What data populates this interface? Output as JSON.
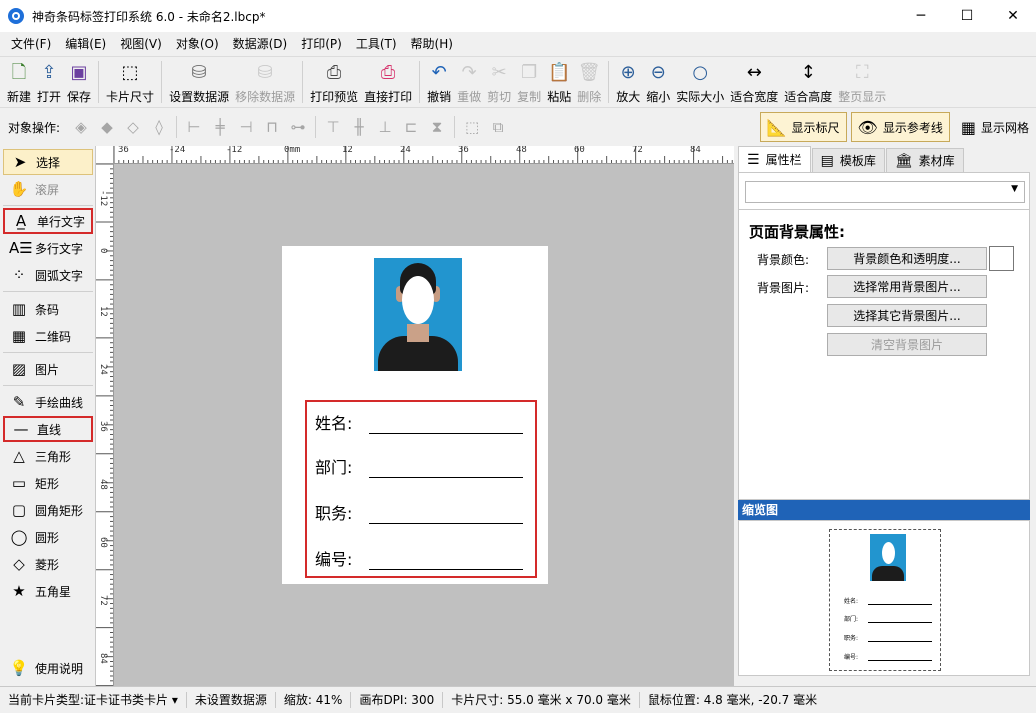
{
  "window": {
    "title": "神奇条码标签打印系统 6.0 - 未命名2.lbcp*",
    "minimize": "─",
    "maximize": "☐",
    "close": "✕"
  },
  "menu": [
    "文件(F)",
    "编辑(E)",
    "视图(V)",
    "对象(O)",
    "数据源(D)",
    "打印(P)",
    "工具(T)",
    "帮助(H)"
  ],
  "toolbar": {
    "new": "新建",
    "open": "打开",
    "save": "保存",
    "card_size": "卡片尺寸",
    "set_datasource": "设置数据源",
    "remove_datasource": "移除数据源",
    "print_preview": "打印预览",
    "direct_print": "直接打印",
    "undo": "撤销",
    "redo": "重做",
    "cut": "剪切",
    "copy": "复制",
    "paste": "粘贴",
    "delete": "删除",
    "zoom_in": "放大",
    "zoom_out": "缩小",
    "actual_size": "实际大小",
    "fit_width": "适合宽度",
    "fit_height": "适合高度",
    "full_page": "整页显示"
  },
  "objbar": {
    "label": "对象操作:",
    "show_ruler": "显示标尺",
    "show_guides": "显示参考线",
    "show_grid": "显示网格"
  },
  "tools": {
    "select": "选择",
    "scroll": "滚屏",
    "single_text": "单行文字",
    "multi_text": "多行文字",
    "arc_text": "圆弧文字",
    "barcode": "条码",
    "qrcode": "二维码",
    "image": "图片",
    "freehand": "手绘曲线",
    "line": "直线",
    "triangle": "三角形",
    "rectangle": "矩形",
    "round_rect": "圆角矩形",
    "circle": "圆形",
    "diamond": "菱形",
    "star": "五角星",
    "help": "使用说明"
  },
  "ruler": {
    "top": [
      "36",
      "-24",
      "-12",
      "0mm",
      "12",
      "24",
      "36",
      "48",
      "60",
      "72",
      "84"
    ],
    "left": [
      "-12",
      "0",
      "12",
      "24",
      "36",
      "48",
      "60",
      "72",
      "84"
    ]
  },
  "card": {
    "fields": [
      "姓名:",
      "部门:",
      "职务:",
      "编号:"
    ]
  },
  "panel": {
    "tabs": [
      "属性栏",
      "模板库",
      "素材库"
    ],
    "section_title": "页面背景属性:",
    "bg_color_label": "背景颜色:",
    "bg_image_label": "背景图片:",
    "bg_color_button": "背景颜色和透明度...",
    "common_bg_button": "选择常用背景图片...",
    "other_bg_button": "选择其它背景图片...",
    "clear_bg_button": "清空背景图片",
    "preview_title": "缩览图"
  },
  "status": {
    "card_type": "当前卡片类型:证卡证书类卡片 ▾",
    "datasource": "未设置数据源",
    "zoom": "缩放: 41%",
    "dpi": "画布DPI: 300",
    "card_size": "卡片尺寸: 55.0 毫米 x 70.0 毫米",
    "mouse_pos": "鼠标位置: 4.8 毫米, -20.7 毫米"
  },
  "colors": {
    "accent": "#1f63b7",
    "highlight": "#d42a2a",
    "photo_bg": "#2295cf"
  }
}
